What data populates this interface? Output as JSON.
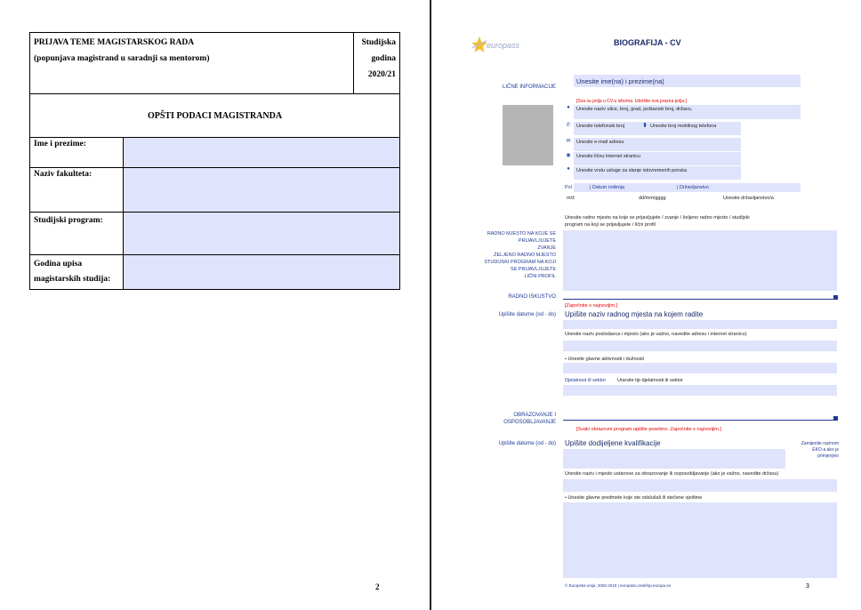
{
  "left_page": {
    "title_line1": "PRIJAVA TEME MAGISTARSKOG RADA",
    "title_line2": "(popunjava magistrand u saradnji sa mentorom)",
    "year_label1": "Studijska",
    "year_label2": "godina",
    "year_value": "2020/21",
    "section_title": "OPŠTI PODACI MAGISTRANDA",
    "fields": [
      {
        "label": "Ime i prezime:"
      },
      {
        "label": "Naziv fakulteta:"
      },
      {
        "label": "Studijski program:"
      },
      {
        "label1": "Godina upisa",
        "label2": "magistarskih studija:"
      }
    ],
    "page_number": "2"
  },
  "right_page": {
    "logo_text": "europass",
    "header_title": "BIOGRAFIJA - CV",
    "personal": {
      "section_label": "LIČNE INFORMACIJE",
      "name_field": "Unesite ime(na) i prezime(na)",
      "hint": "[Sva su polja u CV-u izborna. Izbrišite ova prazna polja.]",
      "address": "Unesite naziv ulice, broj, grad, poštanski broj, državu,",
      "phone": "Unesite telefonski broj",
      "mobile": "Unesite broj mobilnog telefona",
      "email": "Unesite e-mail adresu",
      "web": "Unesite ličnu  internet stranicu",
      "messaging": "Unesite vrstu  usluge za slanje istovremenih poruka",
      "sex_label": "Pol",
      "dob_label": "| Datum rođenja",
      "nationality_label": "| Državljanstvo",
      "sex_value": "m/ž",
      "dob_value": "dd/mm/gggg",
      "nationality_value": "Unesite državljanstvo/a"
    },
    "job_applied": {
      "label": "RADNO MJESTO NA KOJE SE PRIJAVLJUJETE ZVANJE ŽELJENO RADNO MJESTO STUDIJSKI PROGRAM NA KOJI SE PRIJAVLJUJETE LIČNI PROFIL",
      "label_lines": [
        "RADNO MJESTO NA KOJE SE",
        "PRIJAVLJUJETE",
        "ZVANJE",
        "ŽELJENO RADNO MJESTO",
        "STUDIJSKI PROGRAM NA KOJI",
        "SE PRIJAVLJUJETE",
        "LIČNI PROFIL"
      ],
      "text_line1": "Unesite radno mjesto na koje se prijavljujete / zvanje /  željeno radno mjesto / studijski",
      "text_line2": "program na koji se prijavljujete / lični profil"
    },
    "experience": {
      "section_label": "RADNO ISKUSTVO",
      "hint": "[Započnite s najnovijim.]",
      "dates_label": "Upišite datume (od - do)",
      "position": "Upišite naziv radnog mjesta na kojem radite",
      "employer": "Unesite naziv poslodavca i mjesto (ako je važno, navedite adresu i internet stranicu)",
      "activities": "• Unesite glavne aktivnosti i dužnosti",
      "sector_label": "Djelatnost ili sektor",
      "sector_value": "Unesite tip djelatnosti ili sektor"
    },
    "education": {
      "section_label_line1": "OBRAZOVANJE I",
      "section_label_line2": "OSPOSOBLJAVANJE",
      "hint": "[Svaki obrazovni program upišite posebno. Započnite s najnovijim.]",
      "dates_label": "Upišite datume (od - do)",
      "qualification": "Upišite dodijeljene kvalifikacije",
      "eqf_line1": "Zamijenite razinom",
      "eqf_line2": "EKO-a ako je",
      "eqf_line3": "primjenjivo",
      "institution": "Unesite naziv i mjesto ustanove za obrazovanje ili osposobljavanje (ako je važno, navedite državu)",
      "subjects": "• Unesite glavne predmete koje ste odslušali ili stečene vještine"
    },
    "footer": "© Europska unija, 2002-2015 | europass.cedefop.europa.eu",
    "page_number": "3"
  }
}
